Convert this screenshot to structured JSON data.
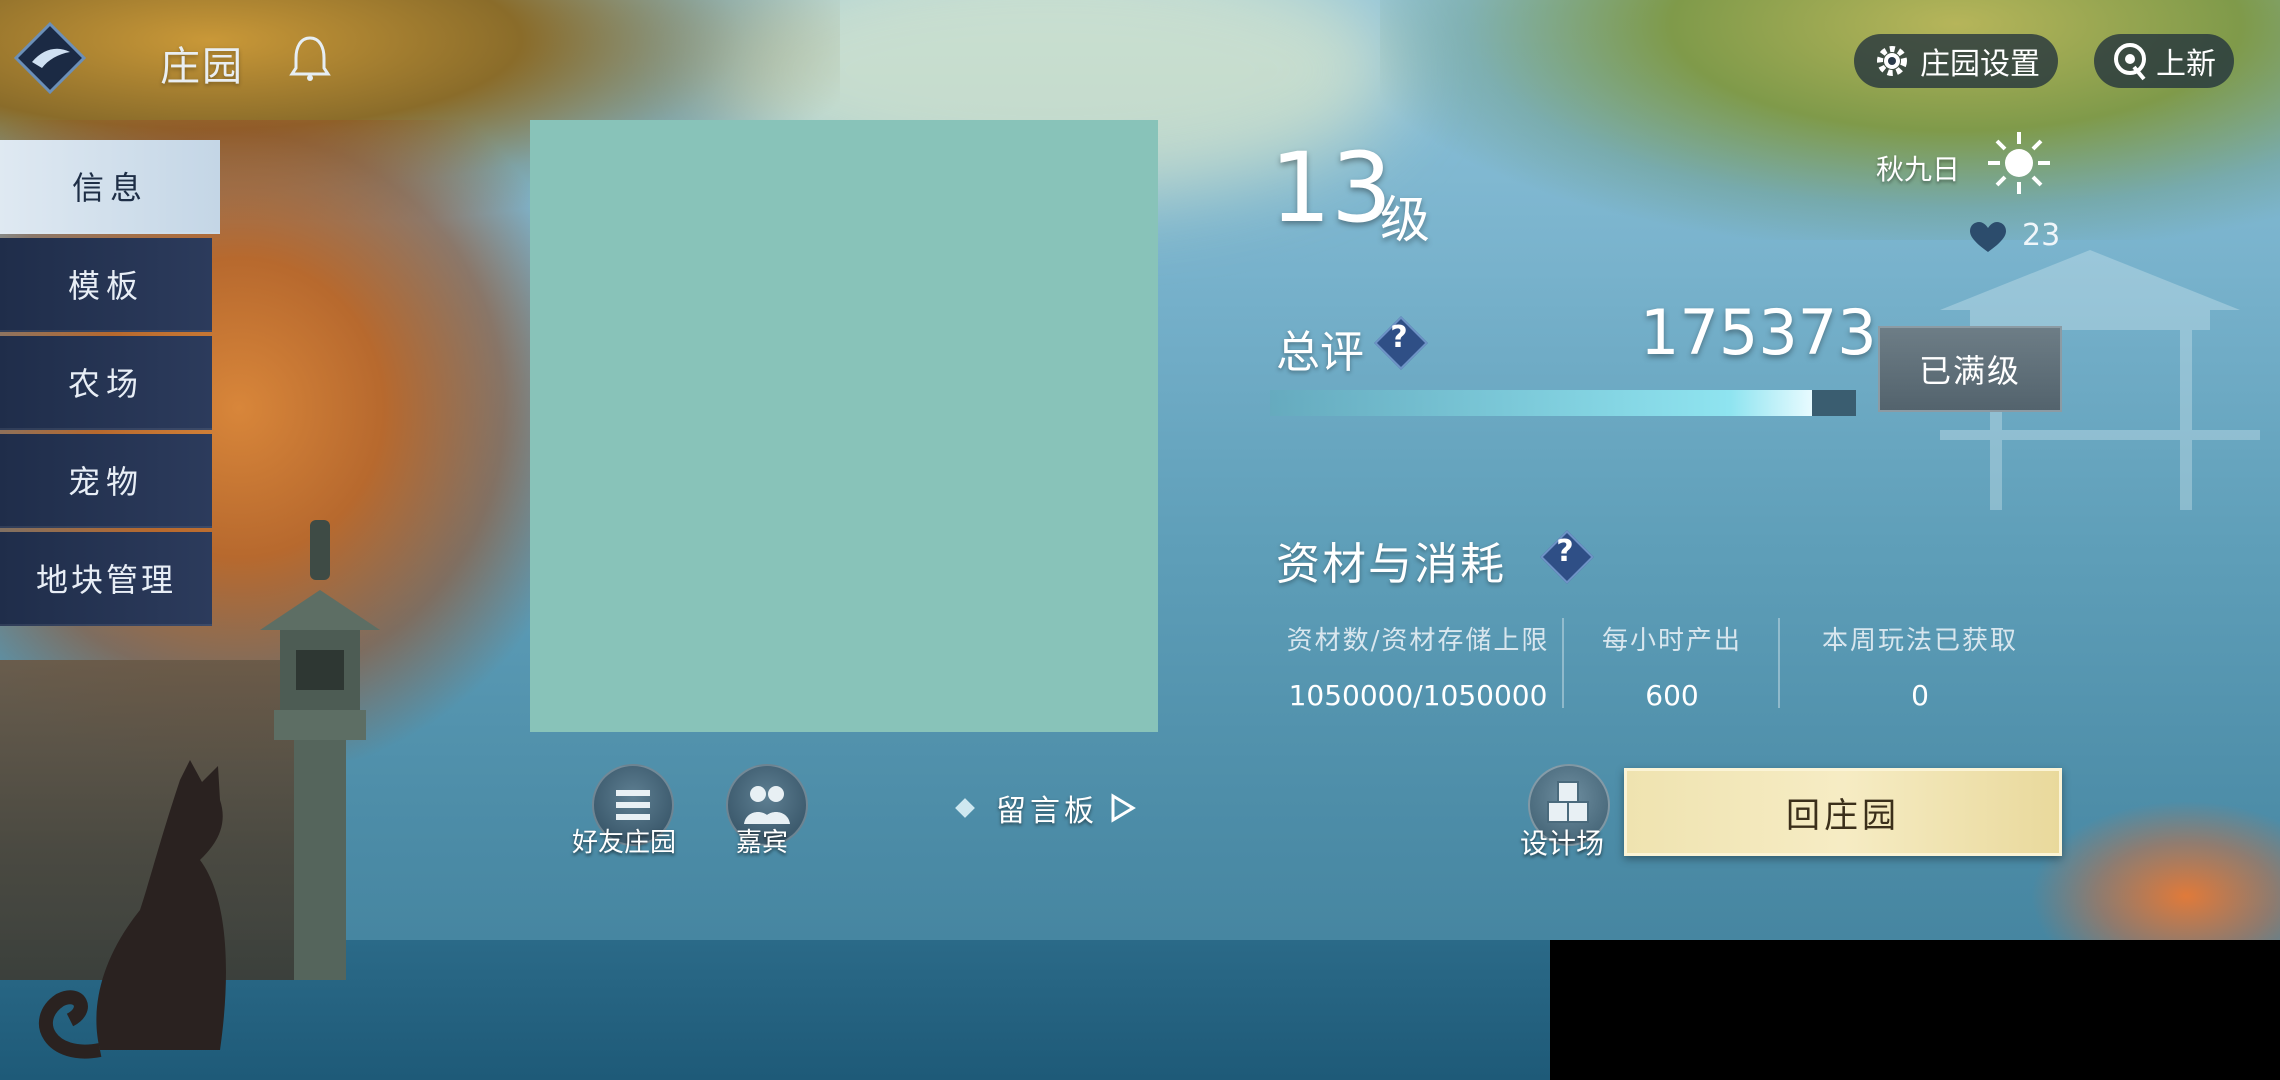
{
  "header": {
    "title": "庄园",
    "settings_label": "庄园设置",
    "new_label": "上新"
  },
  "sidebar": {
    "items": [
      {
        "label": "信息",
        "active": true
      },
      {
        "label": "模板",
        "active": false
      },
      {
        "label": "农场",
        "active": false
      },
      {
        "label": "宠物",
        "active": false
      },
      {
        "label": "地块管理",
        "active": false
      }
    ]
  },
  "actions": {
    "friends_label": "好友庄园",
    "guests_label": "嘉宾",
    "message_board_label": "留言板",
    "design_label": "设计场",
    "return_label": "回庄园"
  },
  "info": {
    "level": "13",
    "level_unit": "级",
    "season": "秋九日",
    "likes": "23",
    "score_label": "总评",
    "help_glyph": "?",
    "score_value": "175373",
    "score_progress": 1.0,
    "maxed_label": "已满级",
    "resources_title": "资材与消耗",
    "resources": [
      {
        "header": "资材数/资材存储上限",
        "value": "1050000/1050000"
      },
      {
        "header": "每小时产出",
        "value": "600"
      },
      {
        "header": "本周玩法已获取",
        "value": "0"
      }
    ]
  },
  "colors": {
    "sidebar_bg": "#2c3b5c",
    "sidebar_active": "#dfe9f2",
    "avatar_placeholder": "#88c3b9",
    "return_button": "#f6ecc4",
    "maxed_button": "#5f6f79"
  },
  "icons": {
    "logo": "diamond-emblem-icon",
    "bell": "bell-icon",
    "settings": "gear-icon",
    "new": "new-arrivals-icon",
    "weather": "sun-icon",
    "likes": "heart-icon",
    "friends": "menu-lines-icon",
    "guests": "people-icon",
    "design": "cubes-icon"
  }
}
